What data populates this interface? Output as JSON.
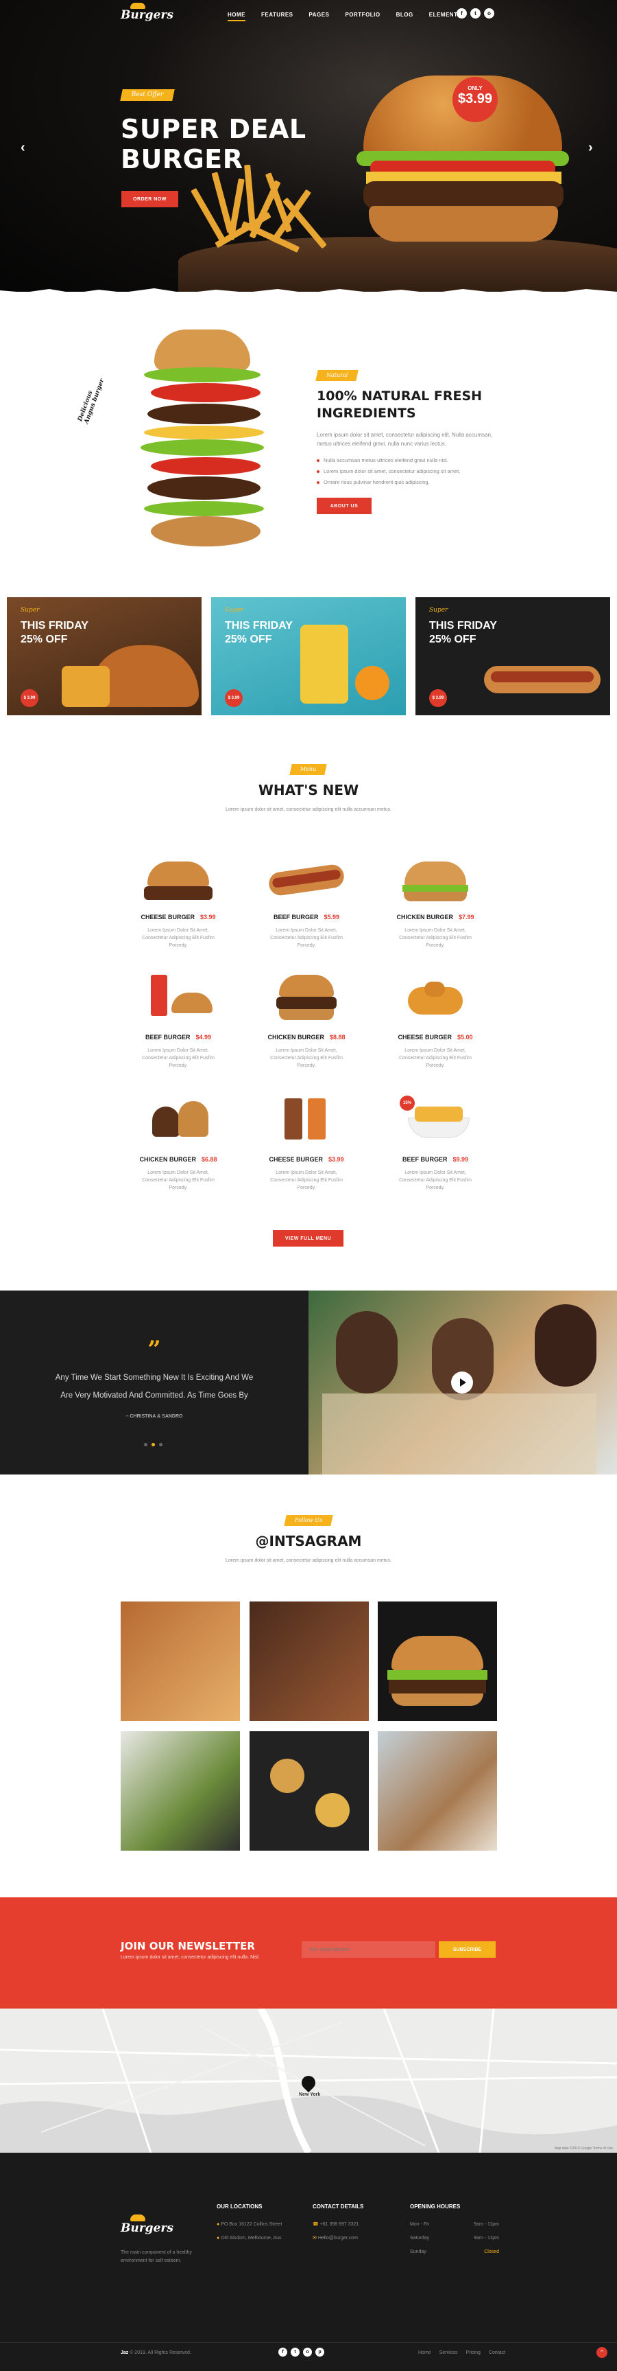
{
  "brand": {
    "name": "Burgers"
  },
  "nav": {
    "items": [
      "HOME",
      "FEATURES",
      "PAGES",
      "PORTFOLIO",
      "BLOG",
      "ELEMENTS"
    ]
  },
  "social": {
    "icons": [
      "facebook-icon",
      "twitter-icon",
      "instagram-icon"
    ],
    "glyphs": [
      "f",
      "t",
      "o"
    ]
  },
  "hero": {
    "tag": "Best Offer",
    "title_line1": "SUPER DEAL",
    "title_line2": "BURGER",
    "button": "ORDER NOW",
    "badge_label": "ONLY",
    "badge_price": "$3.99"
  },
  "natural": {
    "side_label_line1": "Delicious",
    "side_label_line2": "Angus burger",
    "tag": "Natural",
    "title_line1": "100% NATURAL FRESH",
    "title_line2": "INGREDIENTS",
    "body": "Lorem ipsum dolor sit amet, consectetur adipiscing elit. Nulla accumsan, metus ultrices eleifend gravi, nulla nunc varius lectus.",
    "bullets": [
      "Nulla accumsan metus ultrices eleifend gravi nulla nisl.",
      "Lorem ipsum dolor sit amet, consectetur adipiscing sit amet.",
      "Ornare risus pulvinar hendrerit quis adipiscing."
    ],
    "button": "ABOUT US"
  },
  "promos": [
    {
      "tag": "Super",
      "title_line1": "THIS FRIDAY",
      "title_line2": "25% OFF",
      "price": "$ 3.99"
    },
    {
      "tag": "Super",
      "title_line1": "THIS FRIDAY",
      "title_line2": "25% OFF",
      "price": "$ 3.99"
    },
    {
      "tag": "Super",
      "title_line1": "THIS FRIDAY",
      "title_line2": "25% OFF",
      "price": "$ 3.99"
    }
  ],
  "menu": {
    "tag": "Menu",
    "title": "WHAT'S NEW",
    "subtitle": "Lorem ipsum dolor sit amet, consectetur adipiscing elit nulla accumsan metus.",
    "items": [
      {
        "name": "CHEESE BURGER",
        "price": "$3.99",
        "desc": "Lorem Ipsum Dolor Sit Amet, Consectetur Adipiscing Elit Fusfim Porcedy."
      },
      {
        "name": "BEEF BURGER",
        "price": "$5.99",
        "desc": "Lorem Ipsum Dolor Sit Amet, Consectetur Adipiscing Elit Fusfim Porcedy."
      },
      {
        "name": "CHICKEN BURGER",
        "price": "$7.99",
        "desc": "Lorem Ipsum Dolor Sit Amet, Consectetur Adipiscing Elit Fusfim Porcedy."
      },
      {
        "name": "BEEF BURGER",
        "price": "$4.99",
        "desc": "Lorem Ipsum Dolor Sit Amet, Consectetur Adipiscing Elit Fusfim Porcedy."
      },
      {
        "name": "CHICKEN BURGER",
        "price": "$8.88",
        "desc": "Lorem Ipsum Dolor Sit Amet, Consectetur Adipiscing Elit Fusfim Porcedy."
      },
      {
        "name": "CHEESE BURGER",
        "price": "$5.00",
        "desc": "Lorem Ipsum Dolor Sit Amet, Consectetur Adipiscing Elit Fusfim Porcedy."
      },
      {
        "name": "CHICKEN BURGER",
        "price": "$6.88",
        "desc": "Lorem Ipsum Dolor Sit Amet, Consectetur Adipiscing Elit Fusfim Porcedy."
      },
      {
        "name": "CHEESE BURGER",
        "price": "$3.99",
        "desc": "Lorem Ipsum Dolor Sit Amet, Consectetur Adipiscing Elit Fusfim Porcedy."
      },
      {
        "name": "BEEF BURGER",
        "price": "$9.99",
        "desc": "Lorem Ipsum Dolor Sit Amet, Consectetur Adipiscing Elit Fusfim Porcedy."
      }
    ],
    "discount_badge": "15%",
    "button": "VIEW FULL MENU"
  },
  "testimonial": {
    "quote_mark": "”",
    "quote_line1": "Any Time We Start Something New It Is Exciting And We",
    "quote_line2": "Are Very Motivated And Committed. As Time Goes By",
    "author": "– CHRISTINA & SANDRO"
  },
  "instagram": {
    "tag": "Follow Us",
    "title": "@INTSAGRAM",
    "subtitle": "Lorem ipsum dolor sit amet, consectetur adipiscing elit nulla accumsan metus."
  },
  "newsletter": {
    "title": "JOIN OUR NEWSLETTER",
    "subtitle": "Lorem ipsum dolor sit amet, consectetur adipiscing elit nulla. Nisl.",
    "placeholder": "Your email address",
    "button": "SUBSCRIBE"
  },
  "map": {
    "city_label": "New York",
    "attribution": "Map data ©2019 Google  Terms of Use"
  },
  "footer": {
    "tagline_line1": "The main component of a healthy",
    "tagline_line2": "environment for self esteem.",
    "locations_title": "OUR LOCATIONS",
    "locations": [
      "PO Box 16122 Collins Street",
      "Old Alsdom, Melbourne, Aus"
    ],
    "contact_title": "CONTACT DETAILS",
    "contact": [
      "+61 398 697 3321",
      "Hello@burger.com"
    ],
    "hours_title": "OPENING HOURES",
    "hours": [
      {
        "day": "Mon - Fri",
        "time": "9am - 11pm"
      },
      {
        "day": "Saturday",
        "time": "9am - 11pm"
      },
      {
        "day": "Sunday",
        "time": "Closed"
      }
    ],
    "copyright_brand": "Jaz",
    "copyright": "© 2019. All Rights Reserved.",
    "links": [
      "Home",
      "Services",
      "Pricing",
      "Contact"
    ]
  },
  "colors": {
    "accent_red": "#e03a2c",
    "accent_yellow": "#f5b21b",
    "dark": "#1a1a1a"
  }
}
